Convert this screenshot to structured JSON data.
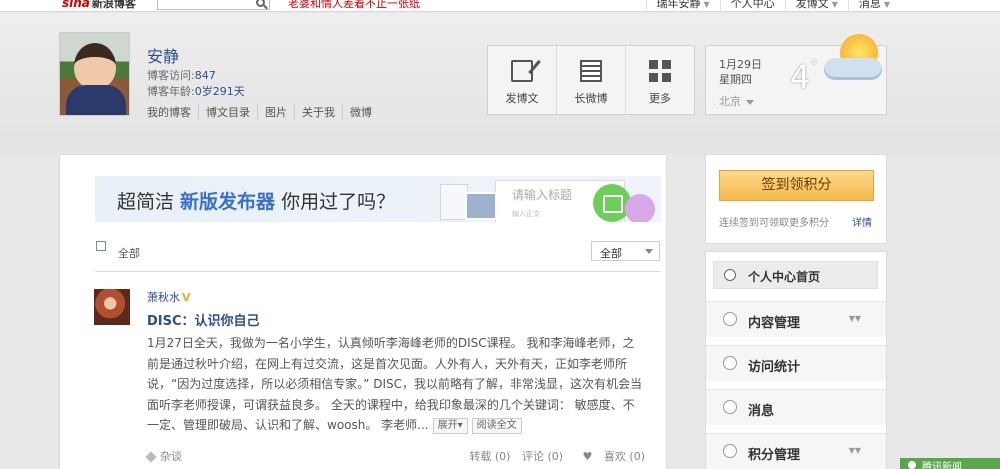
{
  "topbar": {
    "logo_brand": "sina",
    "logo_text": "新浪博客",
    "promo": "老婆和情人差着不止一张纸",
    "links": [
      "瑞年安静",
      "个人中心",
      "发博文",
      "消息"
    ]
  },
  "profile": {
    "name": "安静",
    "visits_label": "博客访问:",
    "visits_value": "847",
    "age_label": "博客年龄:",
    "age_value": "0岁291天",
    "links": [
      "我的博客",
      "博文目录",
      "图片",
      "关于我",
      "微博"
    ]
  },
  "actions": [
    "发博文",
    "长微博",
    "更多"
  ],
  "weather": {
    "date": "1月29日",
    "weekday": "星期四",
    "temp": "4",
    "deg": "°",
    "city": "北京"
  },
  "banner": {
    "text_before": "超简洁 ",
    "text_highlight": "新版发布器",
    "text_after": " 你用过了吗？",
    "placeholder": "请输入标题",
    "placeholder_sub": "输入正文"
  },
  "filter": {
    "label": "全部",
    "select_value": "全部"
  },
  "post": {
    "author": "萧秋水",
    "title": "DISC：认识你自己",
    "body": "1月27日全天，我做为一名小学生，认真倾听李海峰老师的DISC课程。 我和李海峰老师，之前是通过秋叶介绍，在网上有过交流，这是首次见面。人外有人，天外有天，正如李老师所说，“因为过度选择，所以必须相信专家。” DISC，我以前略有了解，非常浅显，这次有机会当面听李老师授课，可谓获益良多。 全天的课程中，给我印象最深的几个关键词： 敏感度、不一定、管理即破局、认识和了解、woosh。 李老师...",
    "expand_btn": "展开",
    "read_btn": "阅读全文",
    "tag": "杂谈",
    "repost": "转载 (0)",
    "comment": "评论 (0)",
    "like": "喜欢 (0)"
  },
  "sidebar": {
    "sign_btn": "签到领积分",
    "sign_tip": "连续签到可领取更多积分",
    "sign_detail": "详情",
    "menu": [
      "个人中心首页",
      "内容管理",
      "访问统计",
      "消息",
      "积分管理"
    ]
  },
  "corner": "腾讯新闻"
}
